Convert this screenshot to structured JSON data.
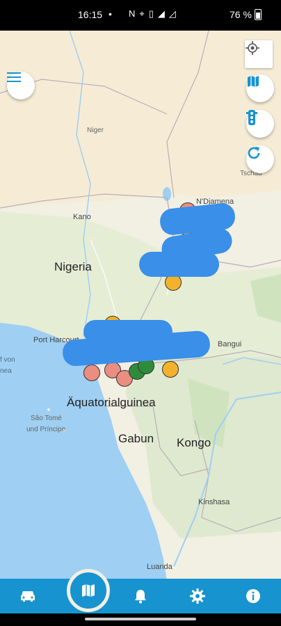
{
  "status_bar": {
    "time": "16:15",
    "dot": "•",
    "icons": [
      "nfc-icon",
      "location-icon",
      "vibrate-icon",
      "wifi-icon",
      "signal-icon"
    ],
    "battery": "76 %"
  },
  "map": {
    "countries": [
      "Nigeria",
      "Äquatorialguinea",
      "Gabun",
      "Kongo",
      "Niger",
      "Tschad"
    ],
    "cities": [
      "N'Djamena",
      "Kano",
      "Port Harcourt",
      "Bangui",
      "Kinshasa",
      "Luanda"
    ],
    "islands": [
      "São Tomé",
      "und Príncipe"
    ],
    "sea": [
      "f von",
      "nea"
    ],
    "partial_country": "n"
  },
  "controls": {
    "locate": "crosshair-icon",
    "map_layers": "map-icon",
    "traffic": "traffic-light-icon",
    "refresh": "refresh-icon",
    "menu": "hamburger-menu-icon"
  },
  "nav": {
    "items": [
      "car-icon",
      "map-icon",
      "bell-icon",
      "gear-icon",
      "info-icon"
    ],
    "active": "map-icon"
  },
  "colors": {
    "accent": "#1793cf",
    "marker_orange": "#f2b22b",
    "marker_salmon": "#e98e80",
    "marker_green": "#2e8b3a",
    "water": "#9fcff2"
  }
}
